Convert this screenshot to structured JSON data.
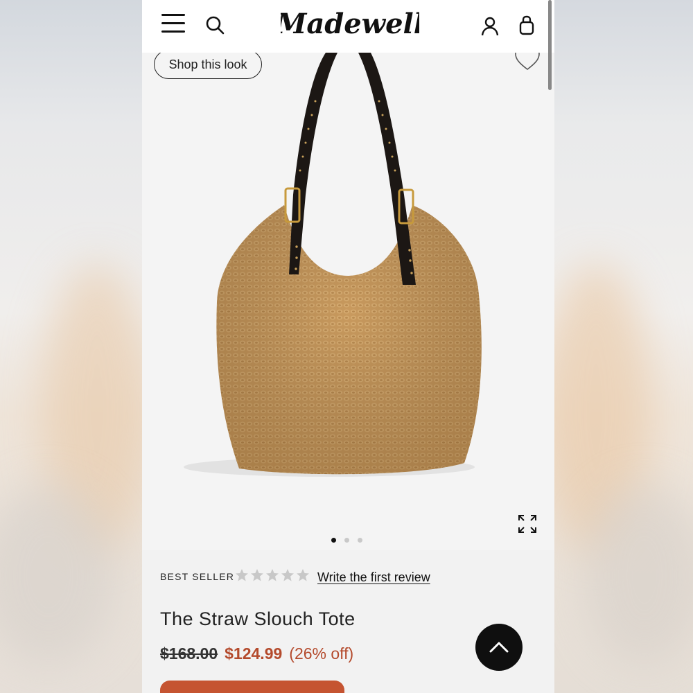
{
  "header": {
    "logo_text": "Madewell",
    "icons": [
      "menu-icon",
      "search-icon",
      "account-icon",
      "shopping-bag-icon"
    ]
  },
  "hero": {
    "shop_look_label": "Shop this look",
    "image_count": 3,
    "active_image_index": 1,
    "icons": [
      "heart-icon",
      "expand-icon"
    ]
  },
  "product": {
    "badge": "BEST SELLER",
    "rating_stars_filled": 0,
    "rating_stars_total": 5,
    "review_link": "Write the first review",
    "title": "The Straw Slouch Tote",
    "original_price": "$168.00",
    "sale_price": "$124.99",
    "discount": "(26% off)"
  },
  "colors": {
    "sale_red": "#b44a2c",
    "promo_bg": "#c55431",
    "straw": "#c9995c",
    "leather": "#1c1714"
  }
}
